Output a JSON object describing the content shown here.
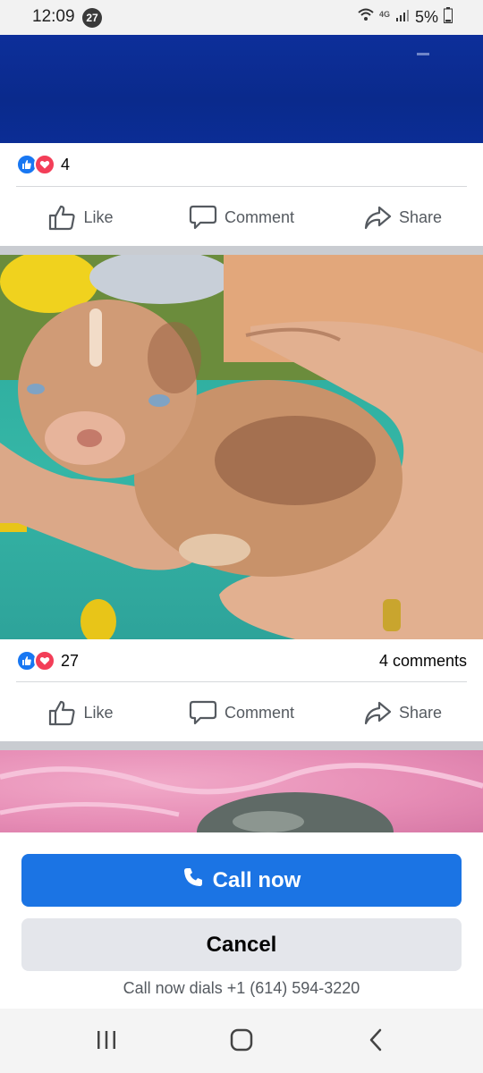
{
  "status_bar": {
    "time": "12:09",
    "notification_count": "27",
    "network": "4G",
    "battery": "5%"
  },
  "post1": {
    "reaction_count": "4",
    "actions": {
      "like": "Like",
      "comment": "Comment",
      "share": "Share"
    }
  },
  "post2": {
    "reaction_count": "27",
    "comments": "4 comments",
    "actions": {
      "like": "Like",
      "comment": "Comment",
      "share": "Share"
    }
  },
  "sheet": {
    "call_label": "Call now",
    "cancel_label": "Cancel",
    "dial_note": "Call now dials +1 (614) 594-3220"
  },
  "colors": {
    "accent": "#1b74e4",
    "like_blue": "#1877f2",
    "love_red": "#f33e58"
  },
  "icons": [
    "wifi-icon",
    "signal-icon",
    "battery-icon",
    "like-icon",
    "comment-icon",
    "share-icon",
    "phone-icon",
    "recent-apps-icon",
    "home-icon",
    "back-icon"
  ]
}
